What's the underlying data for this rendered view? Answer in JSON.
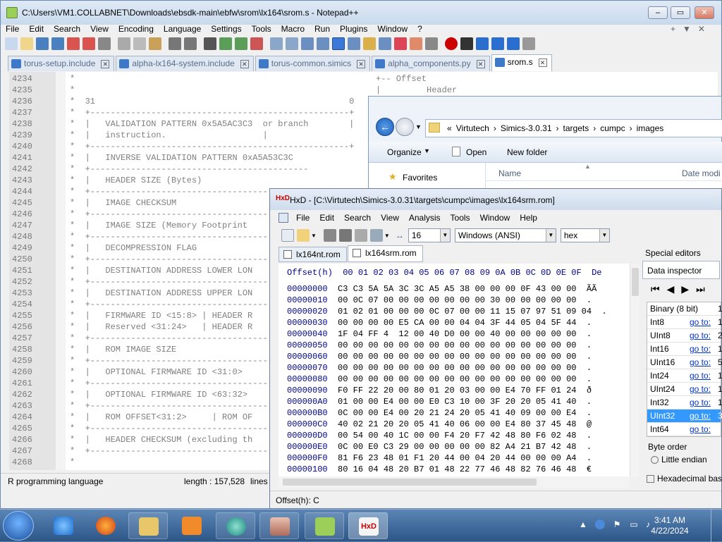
{
  "npp": {
    "title": "C:\\Users\\VM1.COLLABNET\\Downloads\\ebsdk-main\\ebfw\\srom\\lx164\\srom.s - Notepad++",
    "menu": [
      "File",
      "Edit",
      "Search",
      "View",
      "Encoding",
      "Language",
      "Settings",
      "Tools",
      "Macro",
      "Run",
      "Plugins",
      "Window",
      "?"
    ],
    "tabs": [
      {
        "label": "torus-setup.include"
      },
      {
        "label": "alpha-lx164-system.include"
      },
      {
        "label": "torus-common.simics"
      },
      {
        "label": "alpha_components.py"
      },
      {
        "label": "srom.s"
      }
    ],
    "lines": [
      {
        "n": "4234",
        "t": "*"
      },
      {
        "n": "4235",
        "t": "*"
      },
      {
        "n": "4236",
        "t": "*  31                                                  0"
      },
      {
        "n": "4237",
        "t": "*  +---------------------------------------------------+"
      },
      {
        "n": "4238",
        "t": "*  |   VALIDATION PATTERN 0x5A5AC3C3  or branch        |"
      },
      {
        "n": "4239",
        "t": "*  |   instruction.                   |"
      },
      {
        "n": "4240",
        "t": "*  +---------------------------------------------------+"
      },
      {
        "n": "4241",
        "t": "*  |   INVERSE VALIDATION PATTERN 0xA5A53C3C"
      },
      {
        "n": "4242",
        "t": "*  +-------------------------------------------"
      },
      {
        "n": "4243",
        "t": "*  |   HEADER SIZE (Bytes)"
      },
      {
        "n": "4244",
        "t": "*  +-------------------------------------------"
      },
      {
        "n": "4245",
        "t": "*  |   IMAGE CHECKSUM"
      },
      {
        "n": "4246",
        "t": "*  +-------------------------------------------"
      },
      {
        "n": "4247",
        "t": "*  |   IMAGE SIZE (Memory Footprint"
      },
      {
        "n": "4248",
        "t": "*  +-------------------------------------------"
      },
      {
        "n": "4249",
        "t": "*  |   DECOMPRESSION FLAG"
      },
      {
        "n": "4250",
        "t": "*  +-------------------------------------------"
      },
      {
        "n": "4251",
        "t": "*  |   DESTINATION ADDRESS LOWER LON"
      },
      {
        "n": "4252",
        "t": "*  +-------------------------------------------"
      },
      {
        "n": "4253",
        "t": "*  |   DESTINATION ADDRESS UPPER LON"
      },
      {
        "n": "4254",
        "t": "*  +-------------------------------------------"
      },
      {
        "n": "4255",
        "t": "*  |   FIRMWARE ID <15:8> | HEADER R"
      },
      {
        "n": "4256",
        "t": "*  |   Reserved <31:24>   | HEADER R"
      },
      {
        "n": "4257",
        "t": "*  +-------------------------------------------"
      },
      {
        "n": "4258",
        "t": "*  |   ROM IMAGE SIZE"
      },
      {
        "n": "4259",
        "t": "*  +-------------------------------------------"
      },
      {
        "n": "4260",
        "t": "*  |   OPTIONAL FIRMWARE ID <31:0>"
      },
      {
        "n": "4261",
        "t": "*  +-------------------------------------------"
      },
      {
        "n": "4262",
        "t": "*  |   OPTIONAL FIRMWARE ID <63:32>"
      },
      {
        "n": "4263",
        "t": "*  +-------------------------------------------"
      },
      {
        "n": "4264",
        "t": "*  |   ROM OFFSET<31:2>     | ROM OF"
      },
      {
        "n": "4265",
        "t": "*  +-------------------------------------------"
      },
      {
        "n": "4266",
        "t": "*  |   HEADER CHECKSUM (excluding th"
      },
      {
        "n": "4267",
        "t": "*  +-------------------------------------------"
      },
      {
        "n": "4268",
        "t": "*"
      }
    ],
    "right_text_1": "+-- Offset",
    "right_text_2": "|         Header",
    "status_lang": "R programming language",
    "status_length": "length : 157,528",
    "status_lines": "lines"
  },
  "explorer": {
    "breadcrumbs": [
      "«",
      "Virtutech",
      "›",
      "Simics-3.0.31",
      "›",
      "targets",
      "›",
      "cumpc",
      "›",
      "images"
    ],
    "organize": "Organize",
    "open": "Open",
    "new_folder": "New folder",
    "favorites": "Favorites",
    "col_name": "Name",
    "col_date": "Date modi"
  },
  "hxd": {
    "title": "HxD - [C:\\Virtutech\\Simics-3.0.31\\targets\\cumpc\\images\\lx164srm.rom]",
    "menu": [
      "File",
      "Edit",
      "Search",
      "View",
      "Analysis",
      "Tools",
      "Window",
      "Help"
    ],
    "bytes_per_row": "16",
    "charset": "Windows (ANSI)",
    "mode": "hex",
    "tabs": [
      "lx164nt.rom",
      "lx164srm.rom"
    ],
    "header": "Offset(h)  00 01 02 03 04 05 06 07 08 09 0A 0B 0C 0D 0E 0F  De",
    "rows": [
      {
        "o": "00000000",
        "b": "C3 C3 5A 5A 3C 3C A5 A5 38 00 00 00 0F 43 00 00",
        "a": "ÃÃ"
      },
      {
        "o": "00000010",
        "b": "00 0C 07 00 00 00 00 00 00 00 30 00 00 00 00 00",
        "a": "."
      },
      {
        "o": "00000020",
        "b": "01 02 01 00 00 00 0C 07 00 00 11 15 07 97 51 09 04",
        "a": "."
      },
      {
        "o": "00000030",
        "b": "00 00 00 00 E5 CA 00 00 04 04 3F 44 05 04 5F 44",
        "a": "."
      },
      {
        "o": "00000040",
        "b": "1F 04 FF 4  12 00 40 D0 00 00 40 00 00 00 00 00",
        "a": "."
      },
      {
        "o": "00000050",
        "b": "00 00 00 00 00 00 00 00 00 00 00 00 00 00 00 00",
        "a": "."
      },
      {
        "o": "00000060",
        "b": "00 00 00 00 00 00 00 00 00 00 00 00 00 00 00 00",
        "a": "."
      },
      {
        "o": "00000070",
        "b": "00 00 00 00 00 00 00 00 00 00 00 00 00 00 00 00",
        "a": "."
      },
      {
        "o": "00000080",
        "b": "00 00 00 00 00 00 00 00 00 00 00 00 00 00 00 00",
        "a": "."
      },
      {
        "o": "00000090",
        "b": "F0 FF 22 20 00 80 01 20 03 00 00 E4 70 FF 01 24",
        "a": "ð"
      },
      {
        "o": "000000A0",
        "b": "01 00 00 E4 00 00 E0 C3 10 00 3F 20 20 05 41 40",
        "a": "."
      },
      {
        "o": "000000B0",
        "b": "0C 00 00 E4 00 20 21 24 20 05 41 40 09 00 00 E4",
        "a": "."
      },
      {
        "o": "000000C0",
        "b": "40 02 21 20 20 05 41 40 06 00 00 E4 80 37 45 48",
        "a": "@"
      },
      {
        "o": "000000D0",
        "b": "00 54 00 40 1C 00 00 F4 20 F7 42 48 80 F6 02 48",
        "a": "."
      },
      {
        "o": "000000E0",
        "b": "0C 00 E0 C3 29 00 00 00 00 00 82 A4 21 B7 42 48",
        "a": "."
      },
      {
        "o": "000000F0",
        "b": "81 F6 23 48 01 F1 20 44 00 04 20 44 00 00 00 A4",
        "a": "."
      },
      {
        "o": "00000100",
        "b": "80 16 04 48 20 B7 01 48 22 77 46 48 82 76 46 48",
        "a": "€"
      }
    ],
    "special_editors": "Special editors",
    "data_inspector": "Data inspector",
    "inspector": [
      {
        "name": "Binary (8 bit)",
        "goto": "",
        "val": "1"
      },
      {
        "name": "Int8",
        "goto": "go to:",
        "val": "1"
      },
      {
        "name": "UInt8",
        "goto": "go to:",
        "val": "2"
      },
      {
        "name": "Int16",
        "goto": "go to:",
        "val": "1"
      },
      {
        "name": "UInt16",
        "goto": "go to:",
        "val": "5"
      },
      {
        "name": "Int24",
        "goto": "go to:",
        "val": "1"
      },
      {
        "name": "UInt24",
        "goto": "go to:",
        "val": "1"
      },
      {
        "name": "Int32",
        "goto": "go to:",
        "val": "1"
      },
      {
        "name": "UInt32",
        "goto": "go to:",
        "val": "3"
      },
      {
        "name": "Int64",
        "goto": "go to:",
        "val": ""
      }
    ],
    "byte_order": "Byte order",
    "little_endian": "Little endian",
    "hex_basis": "Hexadecimal basi",
    "status": "Offset(h): C"
  },
  "taskbar": {
    "time": "3:41 AM",
    "date": "4/22/2024"
  }
}
